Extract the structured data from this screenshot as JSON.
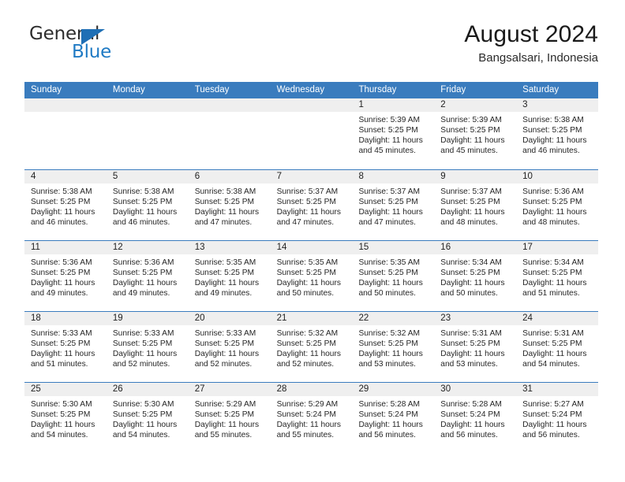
{
  "brand": {
    "name_top": "General",
    "name_bottom": "Blue",
    "accent_color": "#1f6fb5"
  },
  "header": {
    "title": "August 2024",
    "subtitle": "Bangsalsari, Indonesia"
  },
  "theme": {
    "header_bar": "#3a7cbe",
    "day_strip": "#efefef",
    "text": "#262626"
  },
  "weekdays": [
    "Sunday",
    "Monday",
    "Tuesday",
    "Wednesday",
    "Thursday",
    "Friday",
    "Saturday"
  ],
  "weeks": [
    [
      {
        "date": "",
        "empty": true
      },
      {
        "date": "",
        "empty": true
      },
      {
        "date": "",
        "empty": true
      },
      {
        "date": "",
        "empty": true
      },
      {
        "date": "1",
        "sunrise": "Sunrise: 5:39 AM",
        "sunset": "Sunset: 5:25 PM",
        "daylight": "Daylight: 11 hours and 45 minutes."
      },
      {
        "date": "2",
        "sunrise": "Sunrise: 5:39 AM",
        "sunset": "Sunset: 5:25 PM",
        "daylight": "Daylight: 11 hours and 45 minutes."
      },
      {
        "date": "3",
        "sunrise": "Sunrise: 5:38 AM",
        "sunset": "Sunset: 5:25 PM",
        "daylight": "Daylight: 11 hours and 46 minutes."
      }
    ],
    [
      {
        "date": "4",
        "sunrise": "Sunrise: 5:38 AM",
        "sunset": "Sunset: 5:25 PM",
        "daylight": "Daylight: 11 hours and 46 minutes."
      },
      {
        "date": "5",
        "sunrise": "Sunrise: 5:38 AM",
        "sunset": "Sunset: 5:25 PM",
        "daylight": "Daylight: 11 hours and 46 minutes."
      },
      {
        "date": "6",
        "sunrise": "Sunrise: 5:38 AM",
        "sunset": "Sunset: 5:25 PM",
        "daylight": "Daylight: 11 hours and 47 minutes."
      },
      {
        "date": "7",
        "sunrise": "Sunrise: 5:37 AM",
        "sunset": "Sunset: 5:25 PM",
        "daylight": "Daylight: 11 hours and 47 minutes."
      },
      {
        "date": "8",
        "sunrise": "Sunrise: 5:37 AM",
        "sunset": "Sunset: 5:25 PM",
        "daylight": "Daylight: 11 hours and 47 minutes."
      },
      {
        "date": "9",
        "sunrise": "Sunrise: 5:37 AM",
        "sunset": "Sunset: 5:25 PM",
        "daylight": "Daylight: 11 hours and 48 minutes."
      },
      {
        "date": "10",
        "sunrise": "Sunrise: 5:36 AM",
        "sunset": "Sunset: 5:25 PM",
        "daylight": "Daylight: 11 hours and 48 minutes."
      }
    ],
    [
      {
        "date": "11",
        "sunrise": "Sunrise: 5:36 AM",
        "sunset": "Sunset: 5:25 PM",
        "daylight": "Daylight: 11 hours and 49 minutes."
      },
      {
        "date": "12",
        "sunrise": "Sunrise: 5:36 AM",
        "sunset": "Sunset: 5:25 PM",
        "daylight": "Daylight: 11 hours and 49 minutes."
      },
      {
        "date": "13",
        "sunrise": "Sunrise: 5:35 AM",
        "sunset": "Sunset: 5:25 PM",
        "daylight": "Daylight: 11 hours and 49 minutes."
      },
      {
        "date": "14",
        "sunrise": "Sunrise: 5:35 AM",
        "sunset": "Sunset: 5:25 PM",
        "daylight": "Daylight: 11 hours and 50 minutes."
      },
      {
        "date": "15",
        "sunrise": "Sunrise: 5:35 AM",
        "sunset": "Sunset: 5:25 PM",
        "daylight": "Daylight: 11 hours and 50 minutes."
      },
      {
        "date": "16",
        "sunrise": "Sunrise: 5:34 AM",
        "sunset": "Sunset: 5:25 PM",
        "daylight": "Daylight: 11 hours and 50 minutes."
      },
      {
        "date": "17",
        "sunrise": "Sunrise: 5:34 AM",
        "sunset": "Sunset: 5:25 PM",
        "daylight": "Daylight: 11 hours and 51 minutes."
      }
    ],
    [
      {
        "date": "18",
        "sunrise": "Sunrise: 5:33 AM",
        "sunset": "Sunset: 5:25 PM",
        "daylight": "Daylight: 11 hours and 51 minutes."
      },
      {
        "date": "19",
        "sunrise": "Sunrise: 5:33 AM",
        "sunset": "Sunset: 5:25 PM",
        "daylight": "Daylight: 11 hours and 52 minutes."
      },
      {
        "date": "20",
        "sunrise": "Sunrise: 5:33 AM",
        "sunset": "Sunset: 5:25 PM",
        "daylight": "Daylight: 11 hours and 52 minutes."
      },
      {
        "date": "21",
        "sunrise": "Sunrise: 5:32 AM",
        "sunset": "Sunset: 5:25 PM",
        "daylight": "Daylight: 11 hours and 52 minutes."
      },
      {
        "date": "22",
        "sunrise": "Sunrise: 5:32 AM",
        "sunset": "Sunset: 5:25 PM",
        "daylight": "Daylight: 11 hours and 53 minutes."
      },
      {
        "date": "23",
        "sunrise": "Sunrise: 5:31 AM",
        "sunset": "Sunset: 5:25 PM",
        "daylight": "Daylight: 11 hours and 53 minutes."
      },
      {
        "date": "24",
        "sunrise": "Sunrise: 5:31 AM",
        "sunset": "Sunset: 5:25 PM",
        "daylight": "Daylight: 11 hours and 54 minutes."
      }
    ],
    [
      {
        "date": "25",
        "sunrise": "Sunrise: 5:30 AM",
        "sunset": "Sunset: 5:25 PM",
        "daylight": "Daylight: 11 hours and 54 minutes."
      },
      {
        "date": "26",
        "sunrise": "Sunrise: 5:30 AM",
        "sunset": "Sunset: 5:25 PM",
        "daylight": "Daylight: 11 hours and 54 minutes."
      },
      {
        "date": "27",
        "sunrise": "Sunrise: 5:29 AM",
        "sunset": "Sunset: 5:25 PM",
        "daylight": "Daylight: 11 hours and 55 minutes."
      },
      {
        "date": "28",
        "sunrise": "Sunrise: 5:29 AM",
        "sunset": "Sunset: 5:24 PM",
        "daylight": "Daylight: 11 hours and 55 minutes."
      },
      {
        "date": "29",
        "sunrise": "Sunrise: 5:28 AM",
        "sunset": "Sunset: 5:24 PM",
        "daylight": "Daylight: 11 hours and 56 minutes."
      },
      {
        "date": "30",
        "sunrise": "Sunrise: 5:28 AM",
        "sunset": "Sunset: 5:24 PM",
        "daylight": "Daylight: 11 hours and 56 minutes."
      },
      {
        "date": "31",
        "sunrise": "Sunrise: 5:27 AM",
        "sunset": "Sunset: 5:24 PM",
        "daylight": "Daylight: 11 hours and 56 minutes."
      }
    ]
  ]
}
